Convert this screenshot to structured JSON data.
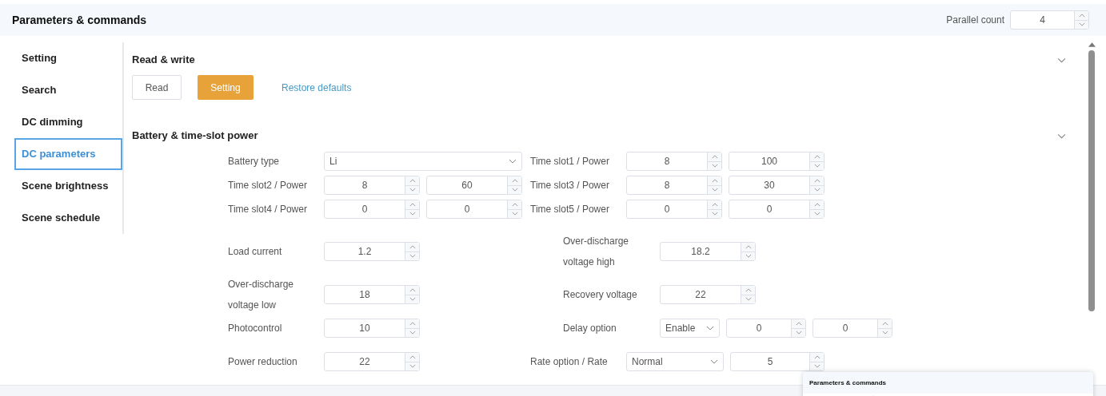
{
  "header": {
    "title": "Parameters & commands",
    "parallel_count": {
      "label": "Parallel count",
      "value": "4"
    }
  },
  "sidebar": {
    "items": [
      {
        "label": "Setting",
        "selected": false
      },
      {
        "label": "Search",
        "selected": false
      },
      {
        "label": "DC dimming",
        "selected": false
      },
      {
        "label": "DC parameters",
        "selected": true
      },
      {
        "label": "Scene brightness",
        "selected": false
      },
      {
        "label": "Scene schedule",
        "selected": false
      }
    ]
  },
  "read_write": {
    "title": "Read & write",
    "buttons": [
      {
        "label": "Read",
        "kind": "default"
      },
      {
        "label": "Setting",
        "kind": "primary"
      },
      {
        "label": "Restore defaults",
        "kind": "link"
      }
    ]
  },
  "battery": {
    "title": "Battery & time-slot power",
    "rows": [
      {
        "left": {
          "label": "Battery type",
          "inputs": [
            {
              "kind": "select",
              "value": "Li"
            }
          ]
        },
        "right": {
          "label": "Time slot1 / Power",
          "inputs": [
            {
              "kind": "number",
              "value": "8"
            },
            {
              "kind": "number",
              "value": "100"
            }
          ]
        }
      },
      {
        "left": {
          "label": "Time slot2 / Power",
          "inputs": [
            {
              "kind": "number",
              "value": "8"
            },
            {
              "kind": "number",
              "value": "60"
            }
          ]
        },
        "right": {
          "label": "Time slot3 / Power",
          "inputs": [
            {
              "kind": "number",
              "value": "8"
            },
            {
              "kind": "number",
              "value": "30"
            }
          ]
        }
      },
      {
        "left": {
          "label": "Time slot4 / Power",
          "inputs": [
            {
              "kind": "number",
              "value": "0"
            },
            {
              "kind": "number",
              "value": "0"
            }
          ]
        },
        "right": {
          "label": "Time slot5 / Power",
          "inputs": [
            {
              "kind": "number",
              "value": "0"
            },
            {
              "kind": "number",
              "value": "0"
            }
          ]
        }
      }
    ],
    "params": [
      {
        "left": {
          "label": "Load current",
          "inputs": [
            {
              "kind": "number",
              "value": "1.2"
            }
          ]
        },
        "right": {
          "label": "Over-discharge voltage high",
          "inputs": [
            {
              "kind": "number",
              "value": "18.2"
            }
          ]
        }
      },
      {
        "left": {
          "label": "Over-discharge voltage low",
          "inputs": [
            {
              "kind": "number",
              "value": "18"
            }
          ]
        },
        "right": {
          "label": "Recovery voltage",
          "inputs": [
            {
              "kind": "number",
              "value": "22"
            }
          ]
        }
      },
      {
        "left": {
          "label": "Photocontrol",
          "inputs": [
            {
              "kind": "number",
              "value": "10"
            }
          ]
        },
        "right": {
          "label": "Delay option",
          "inputs": [
            {
              "kind": "select",
              "value": "Enable"
            },
            {
              "kind": "number",
              "value": "0"
            },
            {
              "kind": "number",
              "value": "0"
            }
          ]
        }
      },
      {
        "left": {
          "label": "Power reduction",
          "inputs": [
            {
              "kind": "number",
              "value": "22"
            }
          ]
        },
        "right": {
          "label": "Rate option / Rate",
          "inputs": [
            {
              "kind": "select",
              "value": "Normal"
            },
            {
              "kind": "number",
              "value": "5"
            }
          ]
        }
      }
    ]
  },
  "popup": {
    "title": "Parameters & commands"
  }
}
